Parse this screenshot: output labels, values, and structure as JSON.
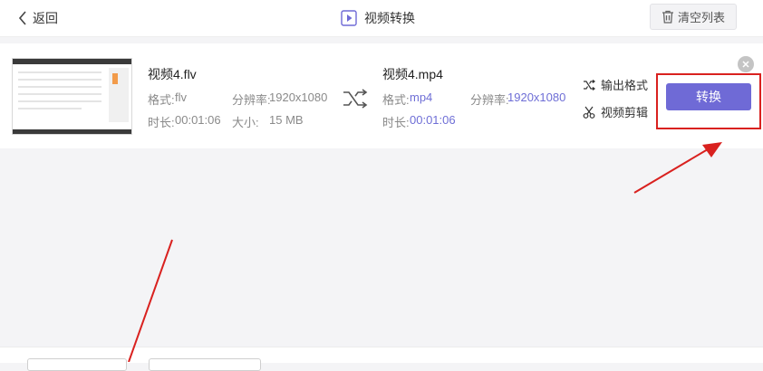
{
  "header": {
    "back_label": "返回",
    "title": "视频转换",
    "clear_label": "清空列表"
  },
  "source_file": {
    "name": "视频4.flv",
    "format_label": "格式:",
    "format": "flv",
    "resolution_label": "分辨率:",
    "resolution": "1920x1080",
    "duration_label": "时长:",
    "duration": "00:01:06",
    "size_label": "大小:",
    "size": "15 MB"
  },
  "target_file": {
    "name": "视频4.mp4",
    "format_label": "格式:",
    "format": "mp4",
    "resolution_label": "分辨率:",
    "resolution": "1920x1080",
    "duration_label": "时长:",
    "duration": "00:01:06"
  },
  "options": {
    "output_format_label": "输出格式",
    "video_edit_label": "视频剪辑"
  },
  "convert_label": "转换",
  "colors": {
    "accent": "#6f6ad6",
    "annotation": "#d9211f"
  }
}
